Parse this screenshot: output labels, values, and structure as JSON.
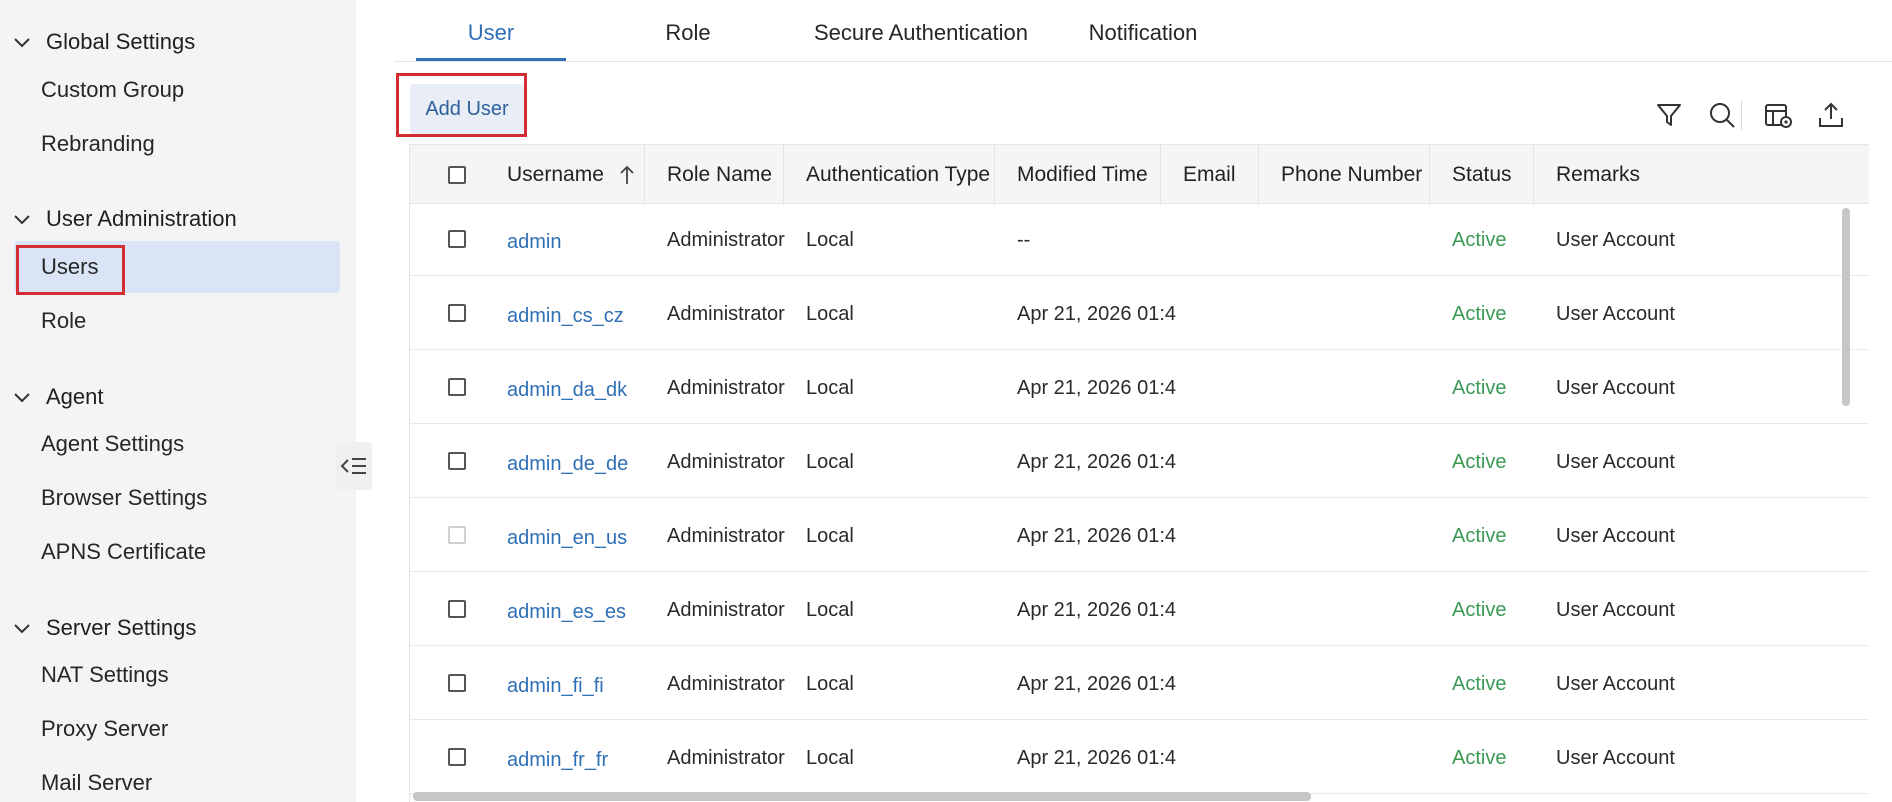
{
  "sidebar": {
    "sections": [
      {
        "title": "Global Settings",
        "items": [
          "Custom Group",
          "Rebranding"
        ]
      },
      {
        "title": "User Administration",
        "items": [
          "Users",
          "Role"
        ]
      },
      {
        "title": "Agent",
        "items": [
          "Agent Settings",
          "Browser Settings",
          "APNS Certificate"
        ]
      },
      {
        "title": "Server Settings",
        "items": [
          "NAT Settings",
          "Proxy Server",
          "Mail Server"
        ]
      }
    ],
    "active_item": "Users"
  },
  "tabs": [
    "User",
    "Role",
    "Secure Authentication",
    "Notification"
  ],
  "active_tab": "User",
  "toolbar": {
    "add_user_label": "Add User",
    "icons": [
      "filter-icon",
      "search-icon",
      "column-settings-icon",
      "export-icon"
    ]
  },
  "table": {
    "columns": [
      "Username",
      "Role Name",
      "Authentication Type",
      "Modified Time",
      "Email",
      "Phone Number",
      "Status",
      "Remarks"
    ],
    "sort_column": "Username",
    "rows": [
      {
        "username": "admin",
        "role": "Administrator",
        "auth": "Local",
        "modified": "--",
        "email": "",
        "phone": "",
        "status": "Active",
        "remarks": "User Account"
      },
      {
        "username": "admin_cs_cz",
        "role": "Administrator",
        "auth": "Local",
        "modified": "Apr 21, 2026 01:4...",
        "email": "",
        "phone": "",
        "status": "Active",
        "remarks": "User Account"
      },
      {
        "username": "admin_da_dk",
        "role": "Administrator",
        "auth": "Local",
        "modified": "Apr 21, 2026 01:4...",
        "email": "",
        "phone": "",
        "status": "Active",
        "remarks": "User Account"
      },
      {
        "username": "admin_de_de",
        "role": "Administrator",
        "auth": "Local",
        "modified": "Apr 21, 2026 01:4...",
        "email": "",
        "phone": "",
        "status": "Active",
        "remarks": "User Account"
      },
      {
        "username": "admin_en_us",
        "role": "Administrator",
        "auth": "Local",
        "modified": "Apr 21, 2026 01:4...",
        "email": "",
        "phone": "",
        "status": "Active",
        "remarks": "User Account"
      },
      {
        "username": "admin_es_es",
        "role": "Administrator",
        "auth": "Local",
        "modified": "Apr 21, 2026 01:4...",
        "email": "",
        "phone": "",
        "status": "Active",
        "remarks": "User Account"
      },
      {
        "username": "admin_fi_fi",
        "role": "Administrator",
        "auth": "Local",
        "modified": "Apr 21, 2026 01:4...",
        "email": "",
        "phone": "",
        "status": "Active",
        "remarks": "User Account"
      },
      {
        "username": "admin_fr_fr",
        "role": "Administrator",
        "auth": "Local",
        "modified": "Apr 21, 2026 01:4...",
        "email": "",
        "phone": "",
        "status": "Active",
        "remarks": "User Account"
      }
    ]
  },
  "colors": {
    "accent": "#2f6fb6",
    "status_active": "#3a9a55",
    "highlight": "#d22d33",
    "sidebar_bg": "#f4f4f6",
    "active_item_bg": "#d9e5f6"
  }
}
